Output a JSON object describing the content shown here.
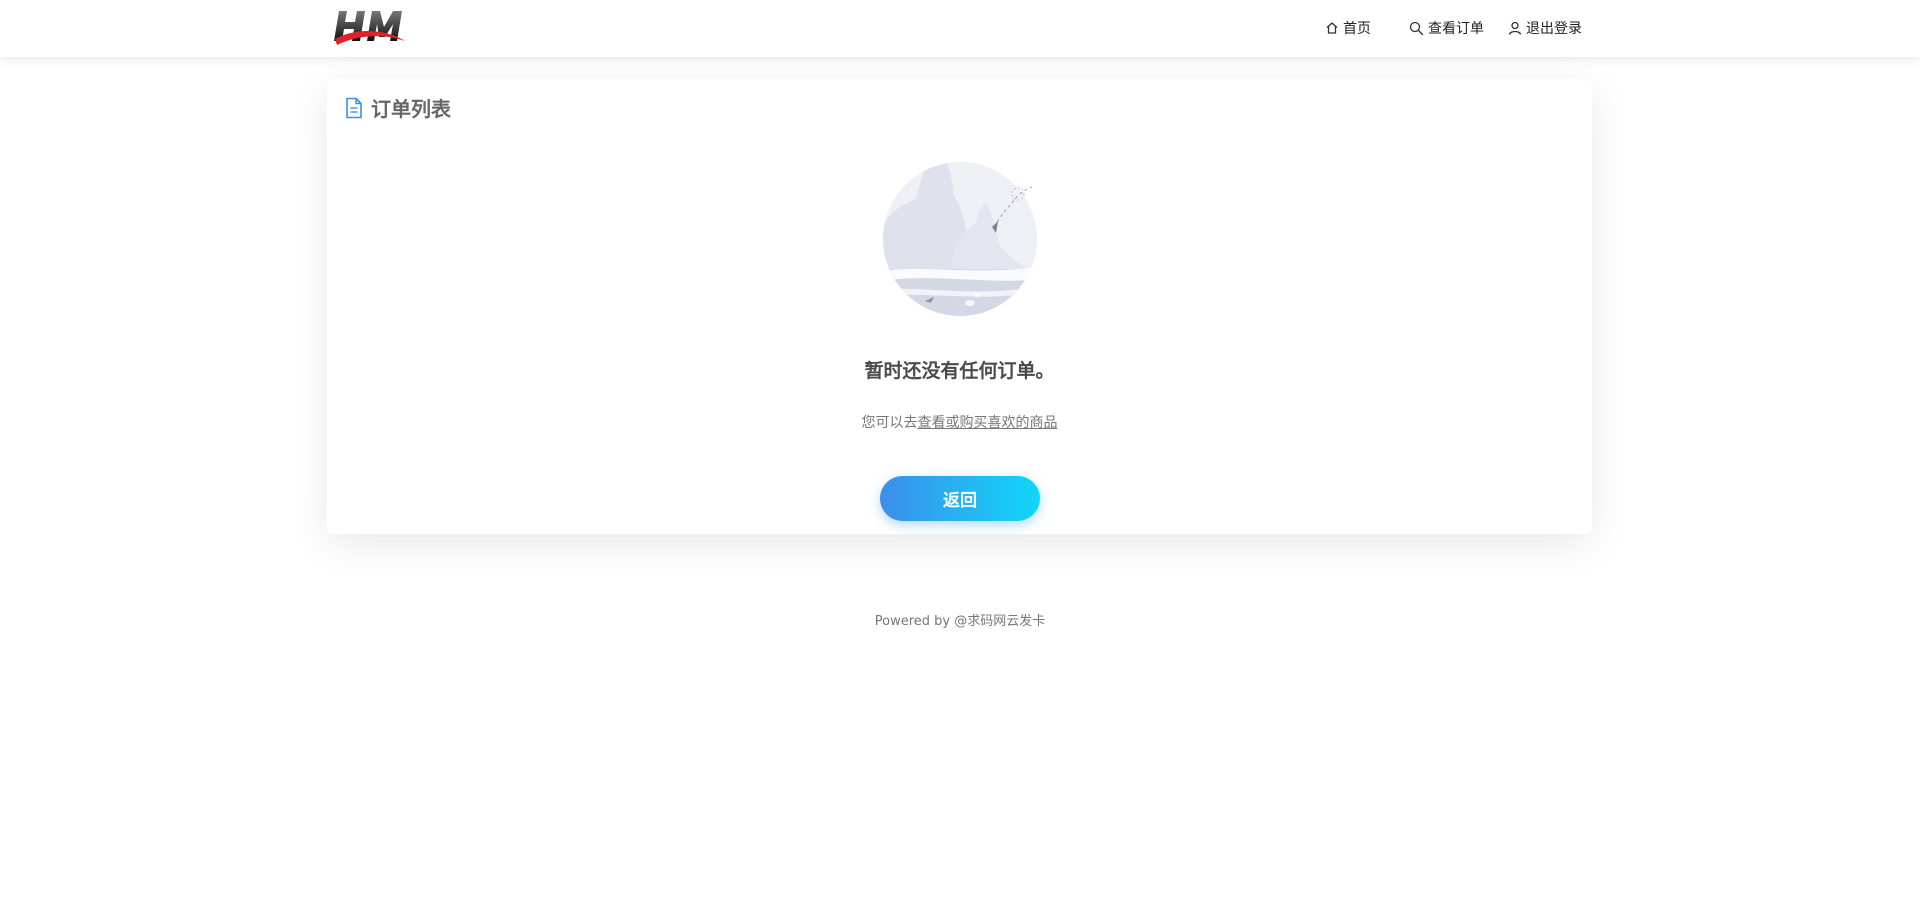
{
  "header": {
    "logo_text": "HM",
    "nav": {
      "home": "首页",
      "orders": "查看订单",
      "logout": "退出登录"
    }
  },
  "main": {
    "title": "订单列表",
    "empty_title": "暂时还没有任何订单。",
    "hint_prefix": "您可以去",
    "hint_link": "查看或购买喜欢的商品",
    "back_label": "返回"
  },
  "footer": {
    "text": "Powered by @求码网云发卡"
  },
  "colors": {
    "accent_start": "#3b8eea",
    "accent_end": "#12d6f8",
    "title_icon": "#3a8ee6"
  },
  "icons": {
    "home": "home-icon",
    "orders": "search-icon",
    "logout": "user-icon",
    "title": "document-icon"
  }
}
